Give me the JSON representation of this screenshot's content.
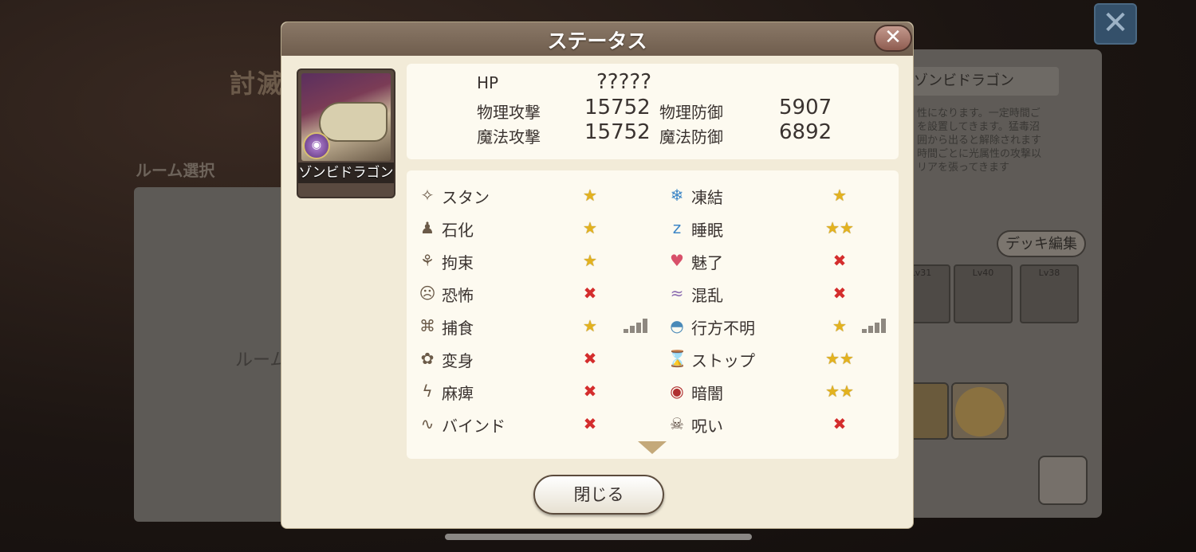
{
  "background": {
    "title": "討滅",
    "section": "ルーム選択",
    "room_text": "ルーム",
    "boss_name": "ゾンビドラゴン",
    "description": [
      "性になります。一定時間ご",
      "を設置してきます。猛毒沼",
      "囲から出ると解除されます",
      "時間ごとに光属性の攻撃以",
      "リアを張ってきます"
    ],
    "deck_button": "デッキ編集",
    "party_cards": [
      "Lv31",
      "Lv40",
      "Lv38"
    ],
    "close_label": "✕"
  },
  "modal": {
    "title": "ステータス",
    "close_x": "✕",
    "portrait_name": "ゾンビドラゴン",
    "stats": {
      "hp_label": "HP",
      "hp_value": "?????",
      "patk_label": "物理攻撃",
      "patk_value": "15752",
      "pdef_label": "物理防御",
      "pdef_value": "5907",
      "matk_label": "魔法攻撃",
      "matk_value": "15752",
      "mdef_label": "魔法防御",
      "mdef_value": "6892"
    },
    "resistances_left": [
      {
        "icon": "✧",
        "label": "スタン",
        "mark": "★",
        "type": "star"
      },
      {
        "icon": "♟",
        "label": "石化",
        "mark": "★",
        "type": "star"
      },
      {
        "icon": "⚘",
        "label": "拘束",
        "mark": "★",
        "type": "star"
      },
      {
        "icon": "☹",
        "label": "恐怖",
        "mark": "✖",
        "type": "x"
      },
      {
        "icon": "⌘",
        "label": "捕食",
        "mark": "★",
        "type": "star",
        "bars": true
      },
      {
        "icon": "✿",
        "label": "変身",
        "mark": "✖",
        "type": "x"
      },
      {
        "icon": "ϟ",
        "label": "麻痺",
        "mark": "✖",
        "type": "x"
      },
      {
        "icon": "∿",
        "label": "バインド",
        "mark": "✖",
        "type": "x"
      }
    ],
    "resistances_right": [
      {
        "icon": "❄",
        "label": "凍結",
        "mark": "★",
        "type": "star"
      },
      {
        "icon": "z",
        "label": "睡眠",
        "mark": "★★",
        "type": "star"
      },
      {
        "icon": "♥",
        "label": "魅了",
        "mark": "✖",
        "type": "x"
      },
      {
        "icon": "≈",
        "label": "混乱",
        "mark": "✖",
        "type": "x"
      },
      {
        "icon": "◓",
        "label": "行方不明",
        "mark": "★",
        "type": "star",
        "bars": true
      },
      {
        "icon": "⌛",
        "label": "ストップ",
        "mark": "★★",
        "type": "star"
      },
      {
        "icon": "◉",
        "label": "暗闇",
        "mark": "★★",
        "type": "star"
      },
      {
        "icon": "☠",
        "label": "呪い",
        "mark": "✖",
        "type": "x"
      }
    ],
    "close_button": "閉じる"
  }
}
